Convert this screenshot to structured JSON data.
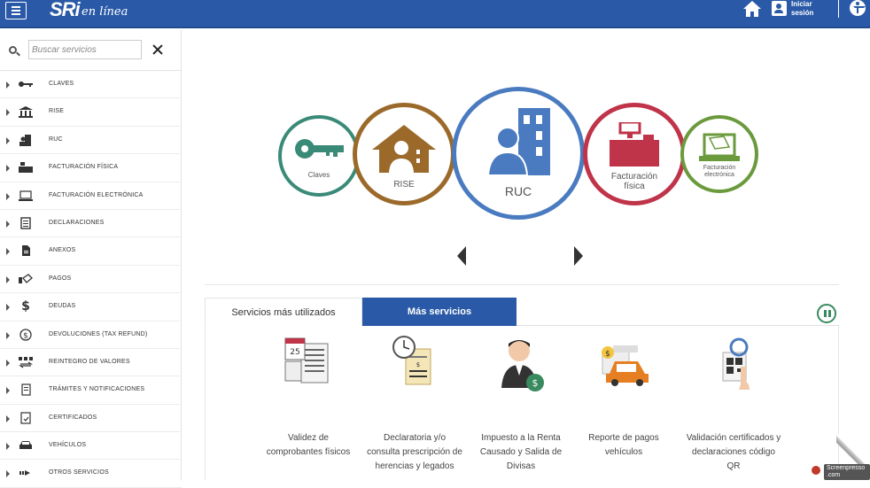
{
  "header": {
    "logo": "SRi",
    "logo_sub": "en línea",
    "login_label": "Iniciar sesión"
  },
  "search": {
    "placeholder": "Buscar servicios"
  },
  "sidebar": {
    "items": [
      {
        "label": "CLAVES",
        "icon": "key-icon"
      },
      {
        "label": "RISE",
        "icon": "bank-icon"
      },
      {
        "label": "RUC",
        "icon": "building-icon"
      },
      {
        "label": "FACTURACIÓN FÍSICA",
        "icon": "cash-register-icon"
      },
      {
        "label": "FACTURACIÓN ELECTRÓNICA",
        "icon": "laptop-icon"
      },
      {
        "label": "DECLARACIONES",
        "icon": "document-list-icon"
      },
      {
        "label": "ANEXOS",
        "icon": "file-icon"
      },
      {
        "label": "PAGOS",
        "icon": "handshake-icon"
      },
      {
        "label": "DEUDAS",
        "icon": "dollar-icon"
      },
      {
        "label": "DEVOLUCIONES (TAX REFUND)",
        "icon": "refund-icon"
      },
      {
        "label": "REINTEGRO DE VALORES",
        "icon": "exchange-icon"
      },
      {
        "label": "TRÁMITES Y NOTIFICACIONES",
        "icon": "notification-doc-icon"
      },
      {
        "label": "CERTIFICADOS",
        "icon": "certificate-icon"
      },
      {
        "label": "VEHÍCULOS",
        "icon": "car-icon"
      },
      {
        "label": "OTROS SERVICIOS",
        "icon": "arrow-right-icon"
      }
    ]
  },
  "carousel": {
    "items": [
      {
        "label": "Claves",
        "color": "#3a8a78"
      },
      {
        "label": "RISE",
        "color": "#9b6a2b"
      },
      {
        "label": "RUC",
        "color": "#4a7bc0"
      },
      {
        "label": "Facturación física",
        "color": "#c0344a"
      },
      {
        "label": "Facturación electrónica",
        "color": "#6a9a3c"
      }
    ]
  },
  "tabs": {
    "tab1": "Servicios más utilizados",
    "tab2": "Más servicios"
  },
  "services": [
    {
      "label": "Validez de comprobantes físicos",
      "icon": "calendar-document-icon"
    },
    {
      "label": "Declaratoria y/o consulta prescripción de herencias y legados",
      "icon": "clock-document-icon"
    },
    {
      "label": "Impuesto a la Renta Causado y Salida de Divisas",
      "icon": "person-money-icon"
    },
    {
      "label": "Reporte de pagos vehículos",
      "icon": "car-payment-icon"
    },
    {
      "label": "Validación certificados y declaraciones código QR",
      "icon": "qr-magnifier-icon"
    }
  ],
  "watermark": {
    "text": "Screenpresso .com"
  }
}
